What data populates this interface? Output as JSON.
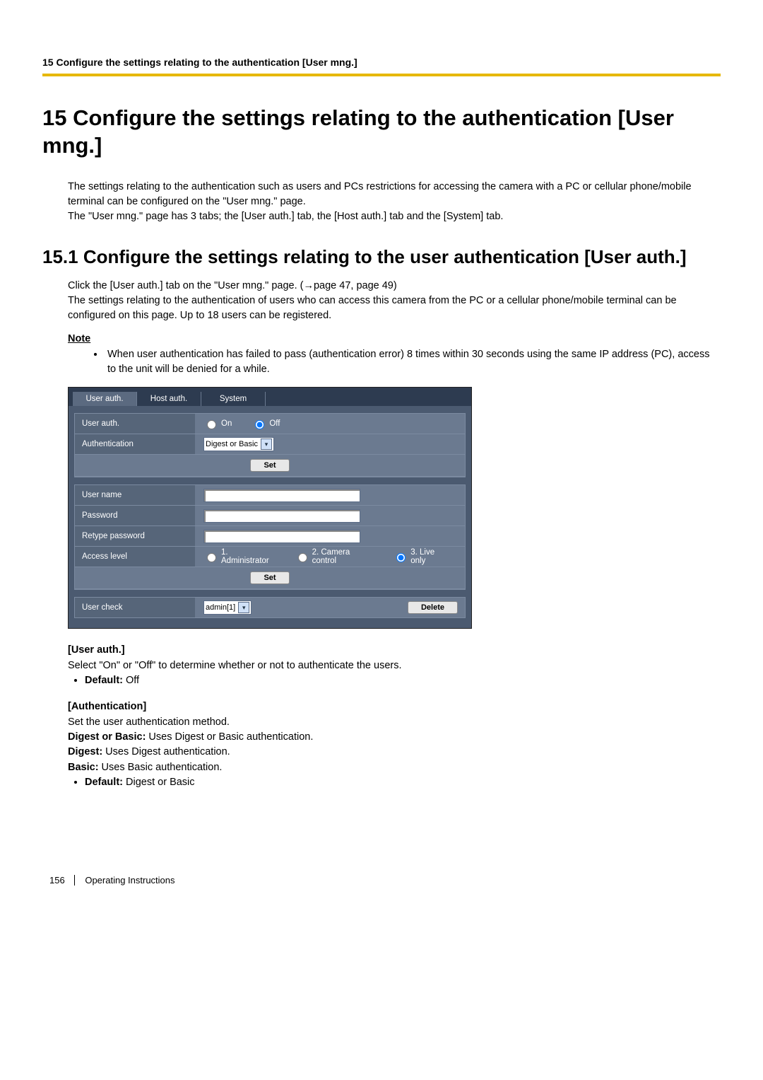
{
  "header": {
    "breadcrumb": "15 Configure the settings relating to the authentication [User mng.]"
  },
  "title": "15   Configure the settings relating to the authentication [User mng.]",
  "intro": [
    "The settings relating to the authentication such as users and PCs restrictions for accessing the camera with a PC or cellular phone/mobile terminal can be configured on the \"User mng.\" page.",
    "The \"User mng.\" page has 3 tabs; the [User auth.] tab, the [Host auth.] tab and the [System] tab."
  ],
  "section_title": "15.1  Configure the settings relating to the user authentication [User auth.]",
  "section_body": [
    "Click the [User auth.] tab on the \"User mng.\" page. (→page 47, page 49)",
    "The settings relating to the authentication of users who can access this camera from the PC or a cellular phone/mobile terminal can be configured on this page. Up to 18 users can be registered."
  ],
  "note_label": "Note",
  "note_items": [
    "When user authentication has failed to pass (authentication error) 8 times within 30 seconds using the same IP address (PC), access to the unit will be denied for a while."
  ],
  "screenshot": {
    "tabs": [
      "User auth.",
      "Host auth.",
      "System"
    ],
    "active_tab": 0,
    "rows": {
      "user_auth_label": "User auth.",
      "user_auth_on": "On",
      "user_auth_off": "Off",
      "auth_label": "Authentication",
      "auth_select": "Digest or Basic",
      "set_btn": "Set",
      "username_label": "User name",
      "password_label": "Password",
      "retype_label": "Retype password",
      "access_label": "Access level",
      "access_opts": [
        "1. Administrator",
        "2. Camera control",
        "3. Live only"
      ],
      "usercheck_label": "User check",
      "usercheck_select": "admin[1]",
      "delete_btn": "Delete"
    }
  },
  "details": {
    "user_auth": {
      "heading": "[User auth.]",
      "text": "Select \"On\" or \"Off\" to determine whether or not to authenticate the users.",
      "default_label": "Default:",
      "default_value": " Off"
    },
    "authentication": {
      "heading": "[Authentication]",
      "line1": "Set the user authentication method.",
      "digest_basic_label": "Digest or Basic:",
      "digest_basic_text": " Uses Digest or Basic authentication.",
      "digest_label": "Digest:",
      "digest_text": " Uses Digest authentication.",
      "basic_label": "Basic:",
      "basic_text": " Uses Basic authentication.",
      "default_label": "Default:",
      "default_value": " Digest or Basic"
    }
  },
  "footer": {
    "page_number": "156",
    "doc_type": "Operating Instructions"
  }
}
